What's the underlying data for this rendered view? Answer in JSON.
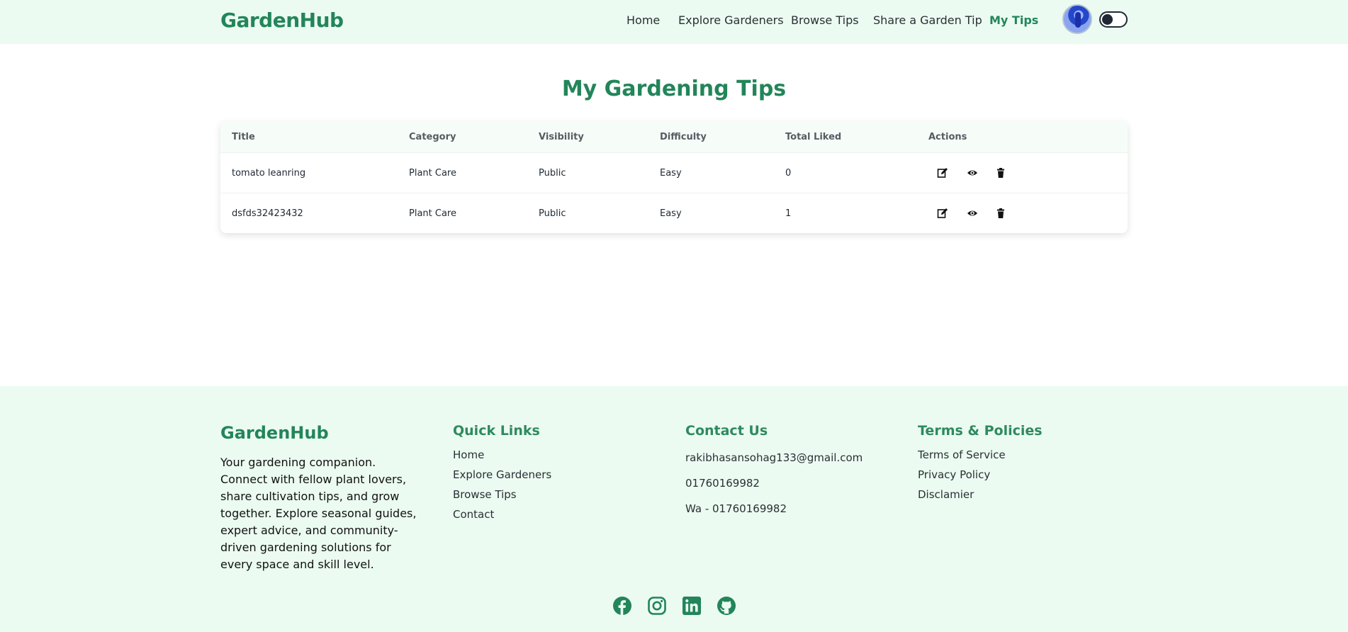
{
  "header": {
    "brand": "GardenHub",
    "nav": [
      {
        "label": "Home"
      },
      {
        "label": "Explore Gardeners"
      },
      {
        "label": "Browse Tips"
      },
      {
        "label": "Share a Garden Tip"
      },
      {
        "label": "My Tips",
        "active": true
      }
    ]
  },
  "main": {
    "title": "My Gardening Tips",
    "table": {
      "columns": [
        "Title",
        "Category",
        "Visibility",
        "Difficulty",
        "Total Liked",
        "Actions"
      ],
      "rows": [
        {
          "title": "tomato leanring",
          "category": "Plant Care",
          "visibility": "Public",
          "difficulty": "Easy",
          "total_liked": "0"
        },
        {
          "title": "dsfds32423432",
          "category": "Plant Care",
          "visibility": "Public",
          "difficulty": "Easy",
          "total_liked": "1"
        }
      ],
      "action_icons": [
        "edit-icon",
        "eye-icon",
        "trash-icon"
      ]
    }
  },
  "footer": {
    "brand": "GardenHub",
    "description": "Your gardening companion. Connect with fellow plant lovers, share cultivation tips, and grow together. Explore seasonal guides, expert advice, and community-driven gardening solutions for every space and skill level.",
    "quick_links": {
      "heading": "Quick Links",
      "items": [
        "Home",
        "Explore Gardeners",
        "Browse Tips",
        "Contact"
      ]
    },
    "contact": {
      "heading": "Contact Us",
      "items": [
        "rakibhasansohag133@gmail.com",
        "01760169982",
        "Wa - 01760169982"
      ]
    },
    "terms": {
      "heading": "Terms & Policies",
      "items": [
        "Terms of Service",
        "Privacy Policy",
        "Disclamier"
      ]
    },
    "social_icons": [
      "facebook-icon",
      "instagram-icon",
      "linkedin-icon",
      "github-icon"
    ]
  },
  "colors": {
    "brand_green": "#23855a",
    "header_bg": "#ebfbf1",
    "footer_bg": "#ebfbf1"
  }
}
